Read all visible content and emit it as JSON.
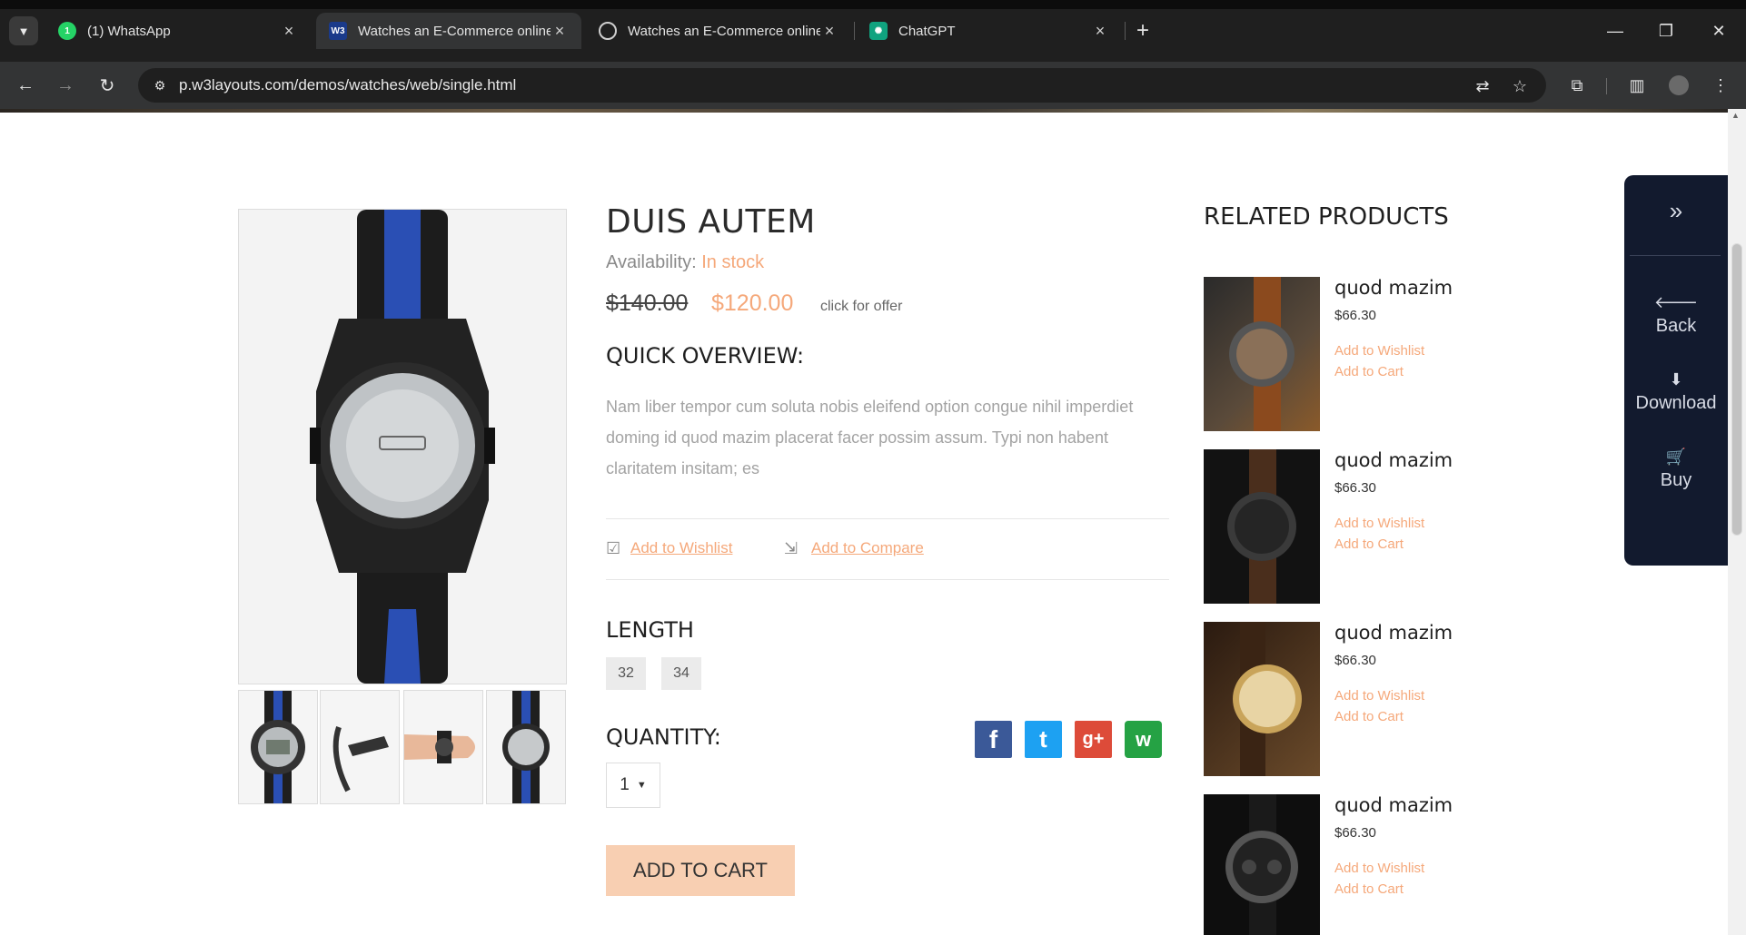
{
  "browser": {
    "tabs": [
      {
        "title": "(1) WhatsApp",
        "active": false
      },
      {
        "title": "Watches an E-Commerce online",
        "active": true
      },
      {
        "title": "Watches an E-Commerce online",
        "active": false
      },
      {
        "title": "ChatGPT",
        "active": false
      }
    ],
    "whatsapp_badge": "1",
    "url": "p.w3layouts.com/demos/watches/web/single.html"
  },
  "product": {
    "title": "DUIS AUTEM",
    "availability_label": "Availability:",
    "availability_value": "In stock",
    "old_price": "$140.00",
    "new_price": "$120.00",
    "offer_text": "click for offer",
    "overview_heading": "QUICK OVERVIEW:",
    "overview_text": "Nam liber tempor cum soluta nobis eleifend option congue nihil imperdiet doming id quod mazim placerat facer possim assum. Typi non habent claritatem insitam; es",
    "wishlist_link": "Add to Wishlist",
    "compare_link": "Add to Compare",
    "length_heading": "LENGTH",
    "lengths": [
      "32",
      "34"
    ],
    "quantity_heading": "QUANTITY:",
    "quantity_value": "1",
    "add_to_cart": "ADD TO CART",
    "social": [
      {
        "name": "facebook",
        "glyph": "f",
        "color": "#3b5998"
      },
      {
        "name": "twitter",
        "glyph": "t",
        "color": "#1da1f2"
      },
      {
        "name": "google-plus",
        "glyph": "g+",
        "color": "#dd4b39"
      },
      {
        "name": "whatsapp",
        "glyph": "w",
        "color": "#25a244"
      }
    ]
  },
  "related": {
    "heading": "RELATED PRODUCTS",
    "items": [
      {
        "name": "quod mazim",
        "price": "$66.30",
        "wishlist": "Add to Wishlist",
        "cart": "Add to Cart"
      },
      {
        "name": "quod mazim",
        "price": "$66.30",
        "wishlist": "Add to Wishlist",
        "cart": "Add to Cart"
      },
      {
        "name": "quod mazim",
        "price": "$66.30",
        "wishlist": "Add to Wishlist",
        "cart": "Add to Cart"
      },
      {
        "name": "quod mazim",
        "price": "$66.30",
        "wishlist": "Add to Wishlist",
        "cart": "Add to Cart"
      }
    ]
  },
  "side_panel": {
    "toggle_icon": "double-chevron-right-icon",
    "items": [
      {
        "label": "Back",
        "icon": "arrow-left-icon"
      },
      {
        "label": "Download",
        "icon": "download-icon"
      },
      {
        "label": "Buy",
        "icon": "cart-icon"
      }
    ]
  },
  "colors": {
    "accent": "#f5a87a",
    "cart_button": "#f8cfb2",
    "side_panel": "#121a2e"
  }
}
